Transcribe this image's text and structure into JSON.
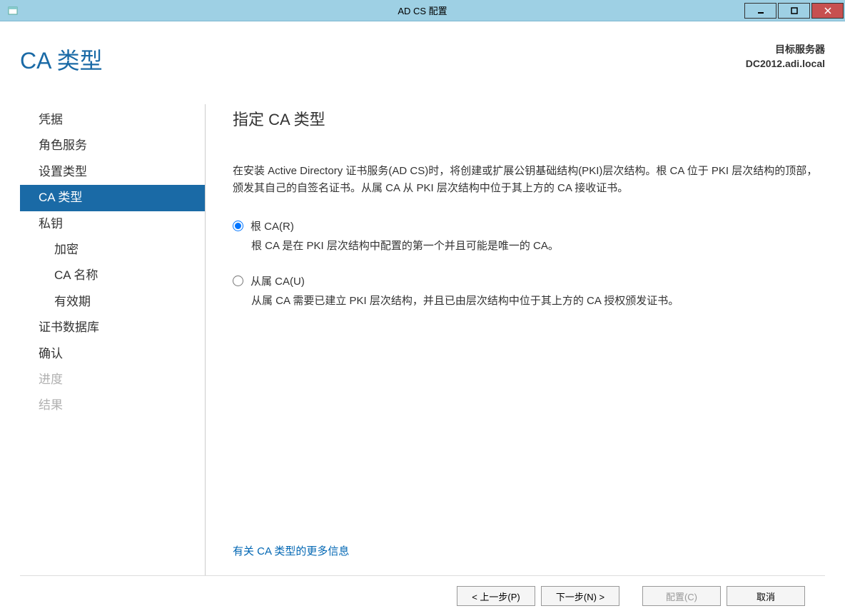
{
  "window": {
    "title": "AD CS 配置"
  },
  "header": {
    "page_title": "CA 类型",
    "target_server_label": "目标服务器",
    "target_server_value": "DC2012.adi.local"
  },
  "sidebar": {
    "items": [
      {
        "label": "凭据",
        "indent": false,
        "selected": false,
        "disabled": false
      },
      {
        "label": "角色服务",
        "indent": false,
        "selected": false,
        "disabled": false
      },
      {
        "label": "设置类型",
        "indent": false,
        "selected": false,
        "disabled": false
      },
      {
        "label": "CA 类型",
        "indent": false,
        "selected": true,
        "disabled": false
      },
      {
        "label": "私钥",
        "indent": false,
        "selected": false,
        "disabled": false
      },
      {
        "label": "加密",
        "indent": true,
        "selected": false,
        "disabled": false
      },
      {
        "label": "CA 名称",
        "indent": true,
        "selected": false,
        "disabled": false
      },
      {
        "label": "有效期",
        "indent": true,
        "selected": false,
        "disabled": false
      },
      {
        "label": "证书数据库",
        "indent": false,
        "selected": false,
        "disabled": false
      },
      {
        "label": "确认",
        "indent": false,
        "selected": false,
        "disabled": false
      },
      {
        "label": "进度",
        "indent": false,
        "selected": false,
        "disabled": true
      },
      {
        "label": "结果",
        "indent": false,
        "selected": false,
        "disabled": true
      }
    ]
  },
  "main": {
    "heading": "指定 CA 类型",
    "description": "在安装 Active Directory 证书服务(AD CS)时，将创建或扩展公钥基础结构(PKI)层次结构。根 CA 位于 PKI 层次结构的顶部，颁发其自己的自签名证书。从属 CA 从 PKI 层次结构中位于其上方的 CA 接收证书。",
    "radios": [
      {
        "label": "根 CA(R)",
        "desc": "根 CA 是在 PKI 层次结构中配置的第一个并且可能是唯一的 CA。",
        "checked": true
      },
      {
        "label": "从属 CA(U)",
        "desc": "从属 CA 需要已建立 PKI 层次结构，并且已由层次结构中位于其上方的 CA 授权颁发证书。",
        "checked": false
      }
    ],
    "more_info": "有关 CA 类型的更多信息"
  },
  "buttons": {
    "prev": "< 上一步(P)",
    "next": "下一步(N) >",
    "configure": "配置(C)",
    "cancel": "取消"
  }
}
